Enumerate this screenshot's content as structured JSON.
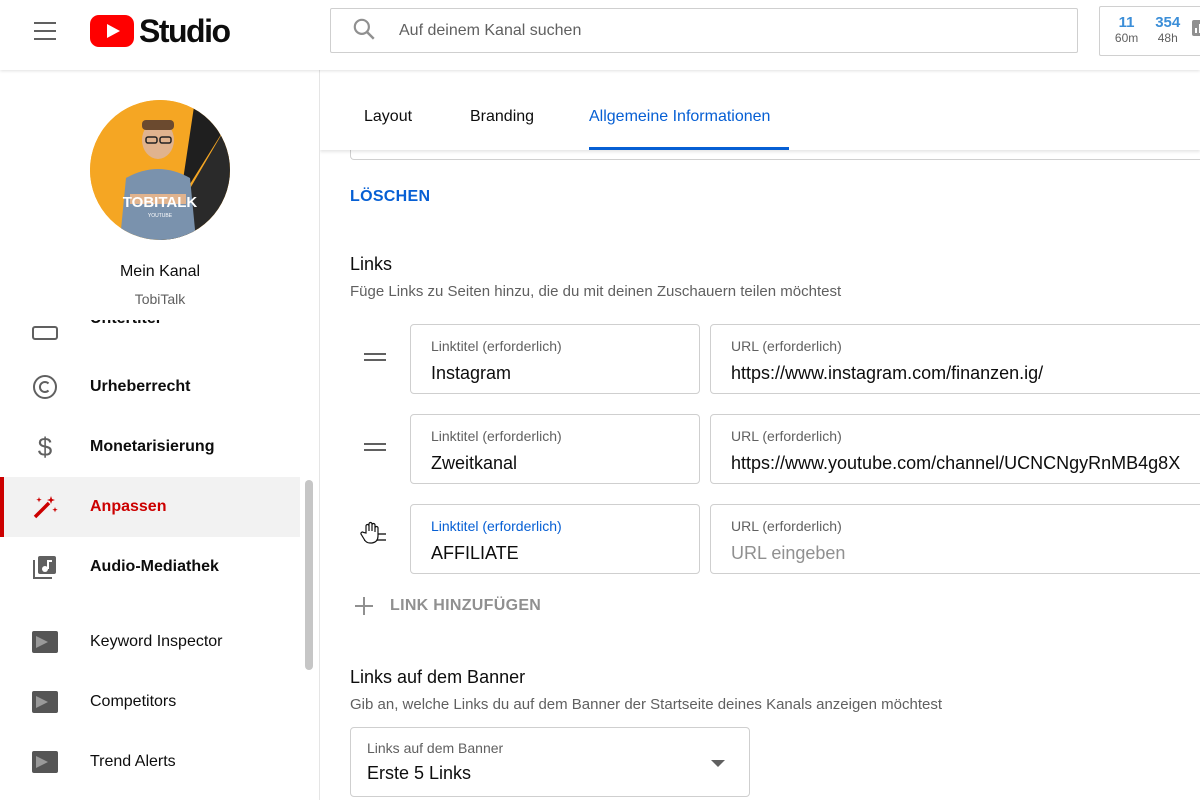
{
  "header": {
    "logo_text": "Studio",
    "search_placeholder": "Auf deinem Kanal suchen",
    "stats": [
      {
        "value": "11",
        "label": "60m"
      },
      {
        "value": "354",
        "label": "48h"
      }
    ]
  },
  "sidebar": {
    "channel_title": "Mein Kanal",
    "channel_name": "TobiTalk",
    "avatar_text": "TOBITALK",
    "avatar_subtext": "YOUTUBE",
    "cut_item_label": "Untertitel",
    "items": [
      {
        "label": "Urheberrecht",
        "icon": "copyright-icon"
      },
      {
        "label": "Monetarisierung",
        "icon": "dollar-icon"
      },
      {
        "label": "Anpassen",
        "icon": "magic-wand-icon",
        "active": true
      },
      {
        "label": "Audio-Mediathek",
        "icon": "audio-library-icon"
      },
      {
        "label": "Keyword Inspector",
        "icon": "keyword-inspector-icon"
      },
      {
        "label": "Competitors",
        "icon": "competitors-icon"
      },
      {
        "label": "Trend Alerts",
        "icon": "trend-alerts-icon"
      }
    ]
  },
  "tabs": [
    {
      "label": "Layout"
    },
    {
      "label": "Branding"
    },
    {
      "label": "Allgemeine Informationen",
      "active": true
    }
  ],
  "main": {
    "delete_label": "LÖSCHEN",
    "links_title": "Links",
    "links_desc": "Füge Links zu Seiten hinzu, die du mit deinen Zuschauern teilen möchtest",
    "links": [
      {
        "title_label": "Linktitel (erforderlich)",
        "title_value": "Instagram",
        "url_label": "URL (erforderlich)",
        "url_value": "https://www.instagram.com/finanzen.ig/",
        "url_placeholder": ""
      },
      {
        "title_label": "Linktitel (erforderlich)",
        "title_value": "Zweitkanal",
        "url_label": "URL (erforderlich)",
        "url_value": "https://www.youtube.com/channel/UCNCNgyRnMB4g8X",
        "url_placeholder": ""
      },
      {
        "title_label": "Linktitel (erforderlich)",
        "title_value": "AFFILIATE",
        "url_label": "URL (erforderlich)",
        "url_value": "",
        "url_placeholder": "URL eingeben"
      }
    ],
    "add_link_label": "LINK HINZUFÜGEN",
    "banner_title": "Links auf dem Banner",
    "banner_desc": "Gib an, welche Links du auf dem Banner der Startseite deines Kanals anzeigen möchtest",
    "banner_select_label": "Links auf dem Banner",
    "banner_select_value": "Erste 5 Links"
  },
  "colors": {
    "accent": "#065fd4",
    "brand_red": "#ff0000",
    "active_red": "#cc0000",
    "stat_blue": "#3b8ed8"
  }
}
